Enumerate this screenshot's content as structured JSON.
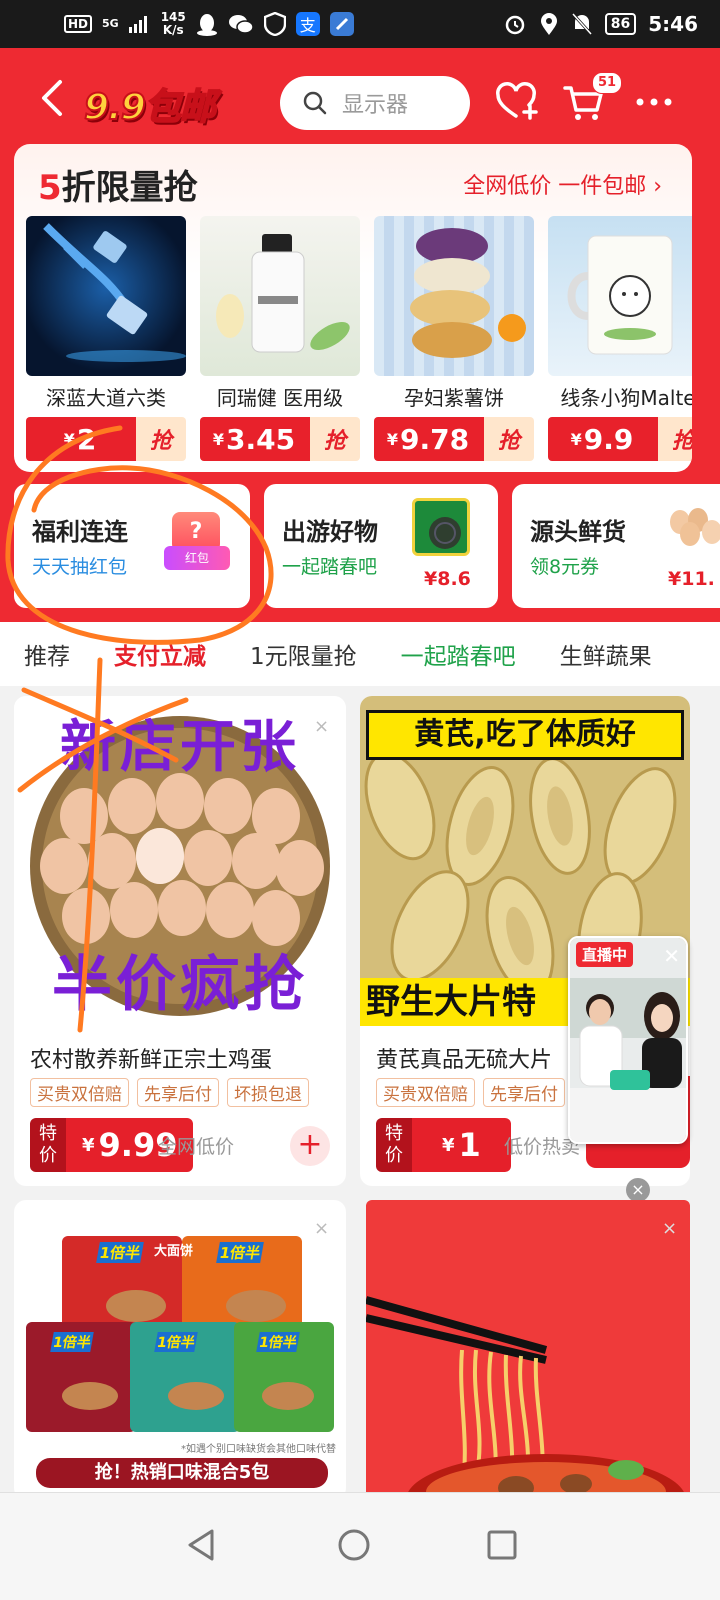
{
  "status_bar": {
    "hd": "HD",
    "network": "5G",
    "speed_value": "145",
    "speed_unit": "K/s",
    "alipay_icon": "支",
    "battery": "86",
    "time": "5:46"
  },
  "header": {
    "brand": "9.9包邮",
    "search_placeholder": "显示器",
    "cart_count": "51"
  },
  "flash_sale": {
    "title_num": "5",
    "title_rest": "折限量抢",
    "link": "全网低价 一件包邮 ›",
    "items": [
      {
        "name": "深蓝大道六类",
        "currency": "¥",
        "price": "2",
        "grab": "抢"
      },
      {
        "name": "同瑞健 医用级",
        "currency": "¥",
        "price": "3.45",
        "grab": "抢"
      },
      {
        "name": "孕妇紫薯饼",
        "currency": "¥",
        "price": "9.78",
        "grab": "抢"
      },
      {
        "name": "线条小狗Malte",
        "currency": "¥",
        "price": "9.9",
        "grab": "抢"
      }
    ]
  },
  "promos": [
    {
      "title": "福利连连",
      "sub": "天天抽红包",
      "icon_text": "红包"
    },
    {
      "title": "出游好物",
      "sub": "一起踏春吧",
      "price": "¥8.6"
    },
    {
      "title": "源头鲜货",
      "sub": "领8元券",
      "price": "¥11."
    }
  ],
  "tabs": [
    "推荐",
    "支付立减",
    "1元限量抢",
    "一起踏春吧",
    "生鲜蔬果"
  ],
  "products": [
    {
      "img_top": "新店开张",
      "img_bottom": "半价疯抢",
      "name": "农村散养新鲜正宗土鸡蛋",
      "tags": [
        "买贵双倍赔",
        "先享后付",
        "坏损包退"
      ],
      "label": "特价",
      "currency": "¥",
      "price": "9.99",
      "low_text": "全网低价",
      "add": "+"
    },
    {
      "img_top": "黄芪,吃了体质好",
      "img_bottom": "野生大片特",
      "name": "黄芪真品无硫大片",
      "tags": [
        "买贵双倍赔",
        "先享后付"
      ],
      "label": "特价",
      "currency": "¥",
      "price": "1",
      "low_text": "低价热卖"
    },
    {
      "banner": "抢！热销口味混合5包",
      "pack_text": "1倍半",
      "pack_brand": "大面饼",
      "footnote": "*如遇个别口味缺货会其他口味代替"
    }
  ],
  "live": {
    "badge": "直播中",
    "close": "✕",
    "dismiss": "×"
  },
  "close_mark": "×"
}
